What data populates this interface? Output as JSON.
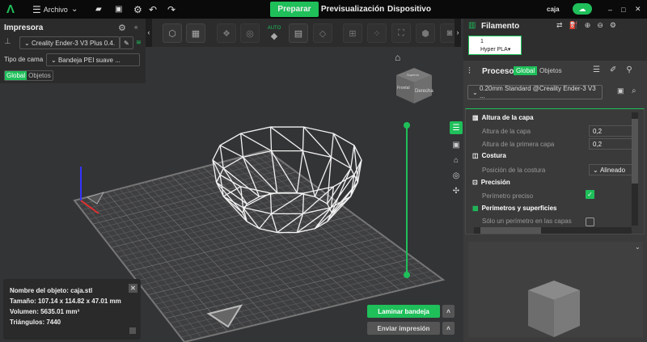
{
  "topbar": {
    "file_menu": "Archivo",
    "tabs": [
      {
        "label": "Preparar",
        "active": true
      },
      {
        "label": "Previsualización"
      },
      {
        "label": "Dispositivo"
      }
    ],
    "project_name": "caja"
  },
  "printer_panel": {
    "title": "Impresora",
    "printer": "Creality Ender-3 V3 Plus 0.4.",
    "bed_label": "Tipo de cama",
    "bed_value": "Bandeja PEI suave ...",
    "tab_global": "Global",
    "tab_objects": "Objetos"
  },
  "toolbar": {
    "auto_label": "AUTO"
  },
  "viewcube": {
    "front": "Frontal",
    "right": "Derecha",
    "top": "Superior"
  },
  "filament": {
    "title": "Filamento",
    "slot": "1",
    "name": "Hyper PLA"
  },
  "process": {
    "title": "Proceso",
    "tab_global": "Global",
    "tab_objects": "Objetos",
    "profile": "0.20mm Standard @Creality Ender-3 V3 ...",
    "sections": [
      {
        "title": "Altura de la capa",
        "rows": [
          {
            "label": "Altura de la capa",
            "value": "0,2"
          },
          {
            "label": "Altura de la primera capa",
            "value": "0,2"
          }
        ]
      },
      {
        "title": "Costura",
        "rows": [
          {
            "label": "Posición de la costura",
            "value": "Alineado"
          }
        ]
      },
      {
        "title": "Precisión",
        "rows": [
          {
            "label": "Perímetro preciso",
            "checked": true
          }
        ]
      },
      {
        "title": "Perímetros y superficies",
        "rows": [
          {
            "label": "Sólo un perímetro en las capas",
            "checked": false
          }
        ]
      }
    ]
  },
  "object_info": {
    "name": "Nombre del objeto: caja.stl",
    "size": "Tamaño: 107.14 x 114.82 x 47.01 mm",
    "volume": "Volumen: 5635.01 mm³",
    "triangles": "Triángulos: 7440"
  },
  "actions": {
    "slice": "Laminar bandeja",
    "send": "Enviar impresión"
  },
  "colors": {
    "accent": "#1fbf5a"
  }
}
